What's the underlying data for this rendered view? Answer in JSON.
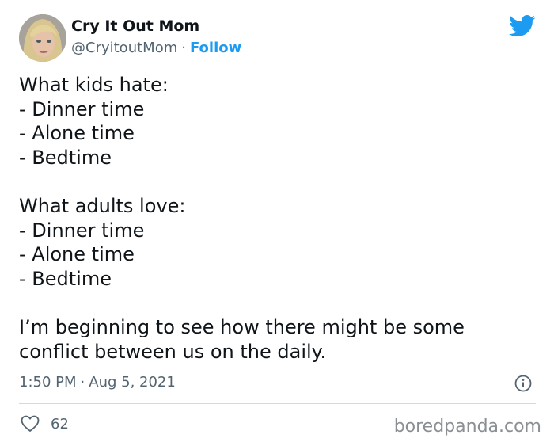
{
  "author": {
    "display_name": "Cry It Out Mom",
    "handle": "@CryitoutMom",
    "separator": "·",
    "follow_label": "Follow"
  },
  "icons": {
    "platform": "twitter-bird-icon",
    "info": "info-icon",
    "like": "heart-icon"
  },
  "colors": {
    "accent": "#1d9bf0",
    "secondary_text": "#536471",
    "divider": "#cfd9de"
  },
  "tweet": {
    "lines": [
      "What kids hate:",
      "- Dinner time",
      "- Alone time",
      "- Bedtime",
      "",
      "What adults love:",
      "- Dinner time",
      "- Alone time",
      "- Bedtime",
      "",
      "I’m beginning to see how there might be some",
      "conflict between us on the daily."
    ],
    "time": "1:50 PM",
    "date": "Aug 5, 2021",
    "meta_separator": "·",
    "likes": "62"
  },
  "watermark": "boredpanda.com"
}
